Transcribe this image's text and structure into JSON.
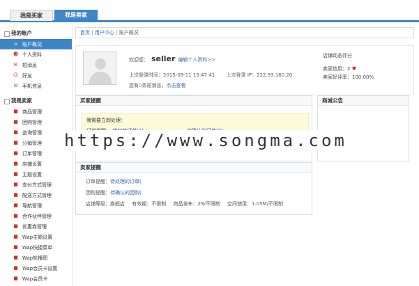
{
  "top_tabs": {
    "buyer": "我是买家",
    "seller": "我是卖家"
  },
  "sidebar": {
    "group_account": "我的账户",
    "account_items": [
      {
        "label": "账户概况",
        "icon": "home-icon",
        "active": true
      },
      {
        "label": "个人资料",
        "icon": "person-icon"
      },
      {
        "label": "短消息",
        "icon": "message-icon"
      },
      {
        "label": "好友",
        "icon": "friends-icon"
      },
      {
        "label": "手机信息",
        "icon": "mail-icon"
      }
    ],
    "group_seller": "我是卖家",
    "seller_items": [
      {
        "label": "商品管理",
        "icon": "goods-icon"
      },
      {
        "label": "团购管理",
        "icon": "group-icon"
      },
      {
        "label": "咨询管理",
        "icon": "consult-icon"
      },
      {
        "label": "分销管理",
        "icon": "distribution-icon"
      },
      {
        "label": "订单管理",
        "icon": "order-icon"
      },
      {
        "label": "店铺设置",
        "icon": "shop-icon"
      },
      {
        "label": "主题设置",
        "icon": "theme-icon"
      },
      {
        "label": "支付方式管理",
        "icon": "payment-icon"
      },
      {
        "label": "配送方式管理",
        "icon": "delivery-icon"
      },
      {
        "label": "导航管理",
        "icon": "nav-icon"
      },
      {
        "label": "合作伙伴管理",
        "icon": "partner-icon"
      },
      {
        "label": "优惠券管理",
        "icon": "coupon-icon"
      },
      {
        "label": "Wap主题设置",
        "icon": "wap-theme-icon"
      },
      {
        "label": "Wap快捷菜单",
        "icon": "wap-menu-icon"
      },
      {
        "label": "Wap轮播图",
        "icon": "wap-slide-icon"
      },
      {
        "label": "Wap会员卡设置",
        "icon": "wap-card-icon"
      },
      {
        "label": "Wap会员卡",
        "icon": "wap-member-icon"
      }
    ]
  },
  "breadcrumb": {
    "home": "首页",
    "center": "用户中心",
    "current": "账户概况"
  },
  "profile": {
    "welcome": "欢迎您：",
    "username": "seller",
    "edit_link": "编辑个人资料>>",
    "last_login_label": "上次登录时间：",
    "last_login_value": "2015-09-11 15:47:41",
    "last_ip_label": "上次登录 IP：",
    "last_ip_value": "222.93.160.20",
    "notice_pre": "您有",
    "notice_count": "0",
    "notice_post": "条短消息，",
    "notice_link": "点击查看"
  },
  "rating": {
    "title": "店铺动态评分",
    "credit_label": "卖家信用：",
    "credit_value": "2",
    "praise_label": "卖家好评率：",
    "praise_value": "100.00%"
  },
  "buyer_box": {
    "title": "买家提醒",
    "tip_title": "我需要立即处理：",
    "order_label": "订单提醒：",
    "pending_pay": "待付款订单(1)",
    "pending_confirm": "待确认的订单(0)"
  },
  "mall_box": {
    "title": "商城公告"
  },
  "seller_box": {
    "title": "卖家提醒",
    "order_label": "订单提醒：",
    "order_link": "待处理的订单(",
    "group_label": "团购提醒：",
    "group_link": "待确认的团购(",
    "shop_level_label": "店铺等级：",
    "shop_level_value": "旗舰店",
    "validity_label": "有效期：",
    "validity_value": "不限制",
    "publish_label": "商品发布：",
    "publish_value": "29/不限制",
    "space_label": "空间使用：",
    "space_value": "1.05M/不限制"
  },
  "watermark": "https://www.songma.com"
}
